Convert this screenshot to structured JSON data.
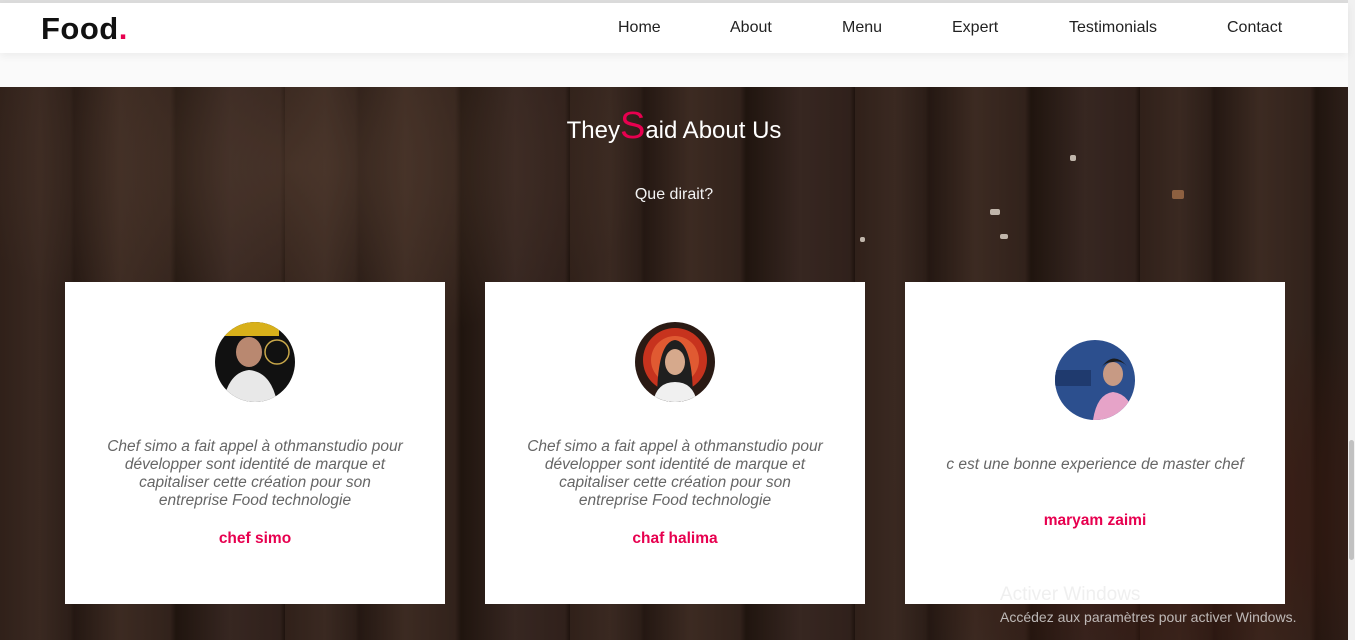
{
  "header": {
    "logo_text": "Food",
    "logo_dot": ".",
    "nav": [
      "Home",
      "About",
      "Menu",
      "Expert",
      "Testimonials",
      "Contact"
    ]
  },
  "section": {
    "title_pre": "They",
    "title_big": "S",
    "title_post": "aid About Us",
    "subtitle": "Que dirait?"
  },
  "testimonials": [
    {
      "quote": "Chef simo a fait appel à othmanstudio pour développer sont identité de marque et capitaliser cette création pour son entreprise Food technologie",
      "name": "chef simo"
    },
    {
      "quote": "Chef simo a fait appel à othmanstudio pour développer sont identité de marque et capitaliser cette création pour son entreprise Food technologie",
      "name": "chaf halima"
    },
    {
      "quote": "c est une bonne experience de master chef",
      "name": "maryam zaimi"
    }
  ],
  "watermark": {
    "line1": "Activer Windows",
    "line2": "Accédez aux paramètres pour activer Windows."
  },
  "colors": {
    "accent": "#e7004f",
    "text": "#222222",
    "card": "#ffffff"
  }
}
